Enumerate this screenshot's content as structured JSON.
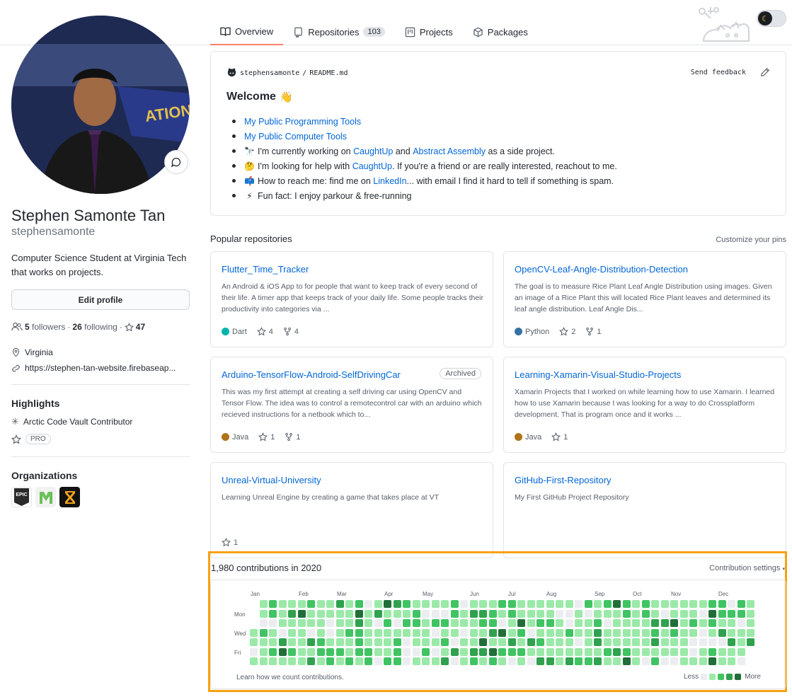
{
  "tabs": [
    {
      "label": "Overview",
      "icon": "book-icon",
      "active": true
    },
    {
      "label": "Repositories",
      "icon": "repo-icon",
      "count": "103"
    },
    {
      "label": "Projects",
      "icon": "project-icon"
    },
    {
      "label": "Packages",
      "icon": "package-icon"
    }
  ],
  "profile": {
    "fullname": "Stephen Samonte Tan",
    "username": "stephensamonte",
    "bio": "Computer Science Student at Virginia Tech that works on projects.",
    "edit_label": "Edit profile",
    "followers": "5",
    "followers_label": "followers",
    "following": "26",
    "following_label": "following",
    "stars": "47",
    "location": "Virginia",
    "website": "https://stephen-tan-website.firebaseap..."
  },
  "highlights": {
    "title": "Highlights",
    "vault": "Arctic Code Vault Contributor",
    "pro": "PRO"
  },
  "organizations": {
    "title": "Organizations",
    "items": [
      "EPIC",
      "",
      ""
    ]
  },
  "readme": {
    "owner": "stephensamonte",
    "sep": "/",
    "file": "README.md",
    "feedback": "Send feedback",
    "welcome": "Welcome",
    "welcome_emoji": "👋",
    "items": [
      {
        "emoji": "",
        "parts": [
          {
            "t": "My Public Programming Tools",
            "link": true
          }
        ]
      },
      {
        "emoji": "",
        "parts": [
          {
            "t": "My Public Computer Tools",
            "link": true
          }
        ]
      },
      {
        "emoji": "🔭",
        "parts": [
          {
            "t": "I'm currently working on "
          },
          {
            "t": "CaughtUp",
            "link": true
          },
          {
            "t": " and "
          },
          {
            "t": "Abstract Assembly",
            "link": true
          },
          {
            "t": " as a side project."
          }
        ]
      },
      {
        "emoji": "🤔",
        "parts": [
          {
            "t": "I'm looking for help with "
          },
          {
            "t": "CaughtUp",
            "link": true
          },
          {
            "t": ". If you're a friend or are really interested, reachout to me."
          }
        ]
      },
      {
        "emoji": "📫",
        "parts": [
          {
            "t": "How to reach me: find me on "
          },
          {
            "t": "LinkedIn",
            "link": true
          },
          {
            "t": "... with email I find it hard to tell if something is spam."
          }
        ]
      },
      {
        "emoji": "⚡",
        "parts": [
          {
            "t": "Fun fact: I enjoy parkour & free-running"
          }
        ]
      }
    ]
  },
  "popular": {
    "title": "Popular repositories",
    "customize": "Customize your pins",
    "repos": [
      {
        "name": "Flutter_Time_Tracker",
        "desc": "An Android & iOS App to for people that want to keep track of every second of their life. A timer app that keeps track of your daily life. Some people tracks their productivity into categories via ...",
        "lang": "Dart",
        "color": "#00B4AB",
        "stars": "4",
        "forks": "4",
        "archived": ""
      },
      {
        "name": "OpenCV-Leaf-Angle-Distribution-Detection",
        "desc": "The goal is to measure Rice Plant Leaf Angle Distribution using images. Given an image of a Rice Plant this will located Rice Plant leaves and determined its leaf angle distribution. Leaf Angle Dis...",
        "lang": "Python",
        "color": "#3572A5",
        "stars": "2",
        "forks": "1",
        "archived": ""
      },
      {
        "name": "Arduino-TensorFlow-Android-SelfDrivingCar",
        "desc": "This was my first attempt at creating a self driving car using OpenCV and Tensor Flow. The idea was to control a remotecontrol car with an arduino which recieved instructions for a netbook which to...",
        "lang": "Java",
        "color": "#b07219",
        "stars": "1",
        "forks": "1",
        "archived": "Archived"
      },
      {
        "name": "Learning-Xamarin-Visual-Studio-Projects",
        "desc": "Xamarin Projects that I worked on while learning how to use Xamarin. I learned how to use Xamarin because I was looking for a way to do Crossplatform development. That is program once and it works ...",
        "lang": "Java",
        "color": "#b07219",
        "stars": "1",
        "forks": "",
        "archived": ""
      },
      {
        "name": "Unreal-Virtual-University",
        "desc": "Learning Unreal Engine by creating a game that takes place at VT",
        "lang": "",
        "color": "",
        "stars": "1",
        "forks": "",
        "archived": ""
      },
      {
        "name": "GitHub-First-Repository",
        "desc": "My First GitHub Project Repository",
        "lang": "",
        "color": "",
        "stars": "",
        "forks": "",
        "archived": ""
      }
    ]
  },
  "contributions": {
    "title": "1,980 contributions in 2020",
    "settings": "Contribution settings",
    "months": [
      "Jan",
      "Feb",
      "Mar",
      "Apr",
      "May",
      "Jun",
      "Jul",
      "Aug",
      "Sep",
      "Oct",
      "Nov",
      "Dec"
    ],
    "days": [
      "Mon",
      "Wed",
      "Fri"
    ],
    "learn": "Learn how we count contributions.",
    "less": "Less",
    "more": "More",
    "palette": [
      "#ebedf0",
      "#9be9a8",
      "#40c463",
      "#30a14e",
      "#216e39"
    ]
  }
}
